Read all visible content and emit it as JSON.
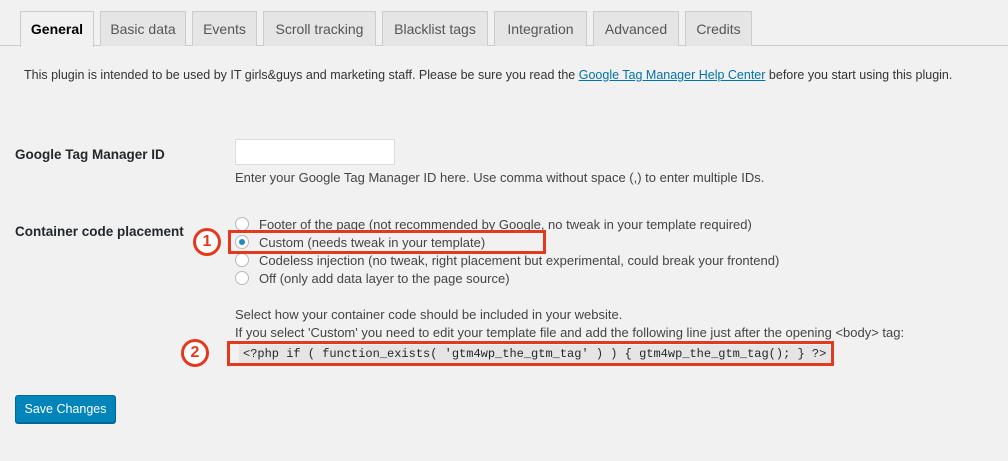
{
  "tabs": [
    {
      "label": "General",
      "active": true
    },
    {
      "label": "Basic data"
    },
    {
      "label": "Events"
    },
    {
      "label": "Scroll tracking"
    },
    {
      "label": "Blacklist tags"
    },
    {
      "label": "Integration"
    },
    {
      "label": "Advanced"
    },
    {
      "label": "Credits"
    }
  ],
  "intro": {
    "before": "This plugin is intended to be used by IT girls&guys and marketing staff. Please be sure you read the ",
    "link": "Google Tag Manager Help Center",
    "after": " before you start using this plugin."
  },
  "gtm_id": {
    "label": "Google Tag Manager ID",
    "value": "",
    "description": "Enter your Google Tag Manager ID here. Use comma without space (,) to enter multiple IDs."
  },
  "placement": {
    "label": "Container code placement",
    "options": [
      {
        "label": "Footer of the page (not recommended by Google, no tweak in your template required)",
        "checked": false
      },
      {
        "label": "Custom (needs tweak in your template)",
        "checked": true
      },
      {
        "label": "Codeless injection (no tweak, right placement but experimental, could break your frontend)",
        "checked": false
      },
      {
        "label": "Off (only add data layer to the page source)",
        "checked": false
      }
    ],
    "help_line1": "Select how your container code should be included in your website.",
    "help_line2": "If you select 'Custom' you need to edit your template file and add the following line just after the opening <body> tag:",
    "code": "<?php if ( function_exists( 'gtm4wp_the_gtm_tag' ) ) { gtm4wp_the_gtm_tag(); } ?>"
  },
  "annotations": {
    "badge1": "1",
    "badge2": "2",
    "color": "#e33a1f"
  },
  "save_label": "Save Changes",
  "colors": {
    "primary_button": "#0085ba",
    "link": "#0073aa",
    "background": "#f1f1f1"
  }
}
